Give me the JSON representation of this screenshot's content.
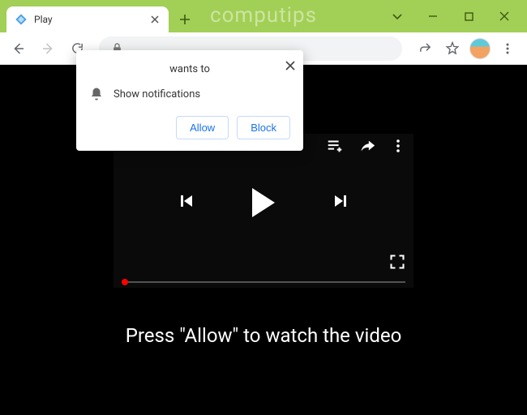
{
  "watermark": "computips",
  "tab": {
    "title": "Play"
  },
  "permission": {
    "heading": "wants to",
    "message": "Show notifications",
    "allow_label": "Allow",
    "block_label": "Block"
  },
  "page": {
    "caption": "Press \"Allow\" to watch the video"
  }
}
